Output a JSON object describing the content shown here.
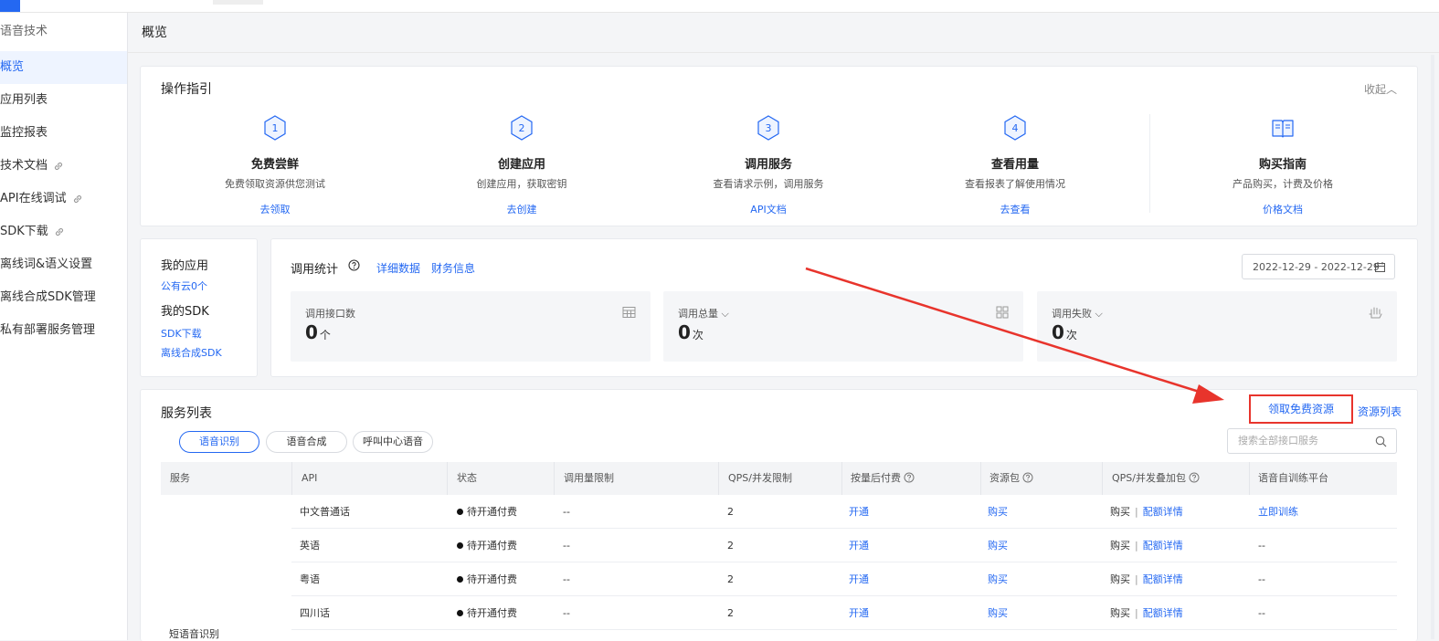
{
  "sidebar": {
    "title": "语音技术",
    "items": [
      {
        "label": "概览"
      },
      {
        "label": "应用列表"
      },
      {
        "label": "监控报表"
      },
      {
        "label": "技术文档"
      },
      {
        "label": "API在线调试"
      },
      {
        "label": "SDK下载"
      },
      {
        "label": "离线词&语义设置"
      },
      {
        "label": "离线合成SDK管理"
      },
      {
        "label": "私有部署服务管理"
      }
    ]
  },
  "page": {
    "title": "概览"
  },
  "guide": {
    "title": "操作指引",
    "collapse": "收起",
    "steps": [
      {
        "num": "1",
        "title": "免费尝鲜",
        "desc": "免费领取资源供您测试",
        "link": "去领取"
      },
      {
        "num": "2",
        "title": "创建应用",
        "desc": "创建应用，获取密钥",
        "link": "去创建"
      },
      {
        "num": "3",
        "title": "调用服务",
        "desc": "查看请求示例，调用服务",
        "link": "API文档"
      },
      {
        "num": "4",
        "title": "查看用量",
        "desc": "查看报表了解使用情况",
        "link": "去查看"
      }
    ],
    "buy": {
      "title": "购买指南",
      "desc": "产品购买，计费及价格",
      "link": "价格文档"
    }
  },
  "my_app": {
    "app_heading": "我的应用",
    "app_link": "公有云0个",
    "sdk_heading": "我的SDK",
    "sdk_link1": "SDK下载",
    "sdk_link2": "离线合成SDK"
  },
  "stats": {
    "title": "调用统计",
    "link_detail": "详细数据",
    "link_finance": "财务信息",
    "date_range": "2022-12-29 - 2022-12-29",
    "metrics": [
      {
        "label": "调用接口数",
        "value": "0",
        "unit": "个"
      },
      {
        "label": "调用总量 ⌵",
        "value": "0",
        "unit": "次"
      },
      {
        "label": "调用失败 ⌵",
        "value": "0",
        "unit": "次"
      }
    ]
  },
  "services": {
    "title": "服务列表",
    "free_resources": "领取免费资源",
    "resource_list": "资源列表",
    "tabs": [
      "语音识别",
      "语音合成",
      "呼叫中心语音"
    ],
    "search_placeholder": "搜索全部接口服务",
    "columns": [
      "服务",
      "API",
      "状态",
      "调用量限制",
      "QPS/并发限制",
      "按量后付费",
      "资源包",
      "QPS/并发叠加包",
      "语音自训练平台"
    ],
    "service_name": "短语音识别",
    "rows": [
      {
        "api": "中文普通话",
        "status": "待开通付费",
        "limit": "--",
        "qps": "2",
        "postpaid": "开通",
        "package": "购买",
        "buy": "购买",
        "quota": "配额详情",
        "training": "立即训练"
      },
      {
        "api": "英语",
        "status": "待开通付费",
        "limit": "--",
        "qps": "2",
        "postpaid": "开通",
        "package": "购买",
        "buy": "购买",
        "quota": "配额详情",
        "training": "--"
      },
      {
        "api": "粤语",
        "status": "待开通付费",
        "limit": "--",
        "qps": "2",
        "postpaid": "开通",
        "package": "购买",
        "buy": "购买",
        "quota": "配额详情",
        "training": "--"
      },
      {
        "api": "四川话",
        "status": "待开通付费",
        "limit": "--",
        "qps": "2",
        "postpaid": "开通",
        "package": "购买",
        "buy": "购买",
        "quota": "配额详情",
        "training": "--"
      }
    ]
  },
  "colors": {
    "accent": "#2468f2",
    "annotation": "#e8342c"
  }
}
